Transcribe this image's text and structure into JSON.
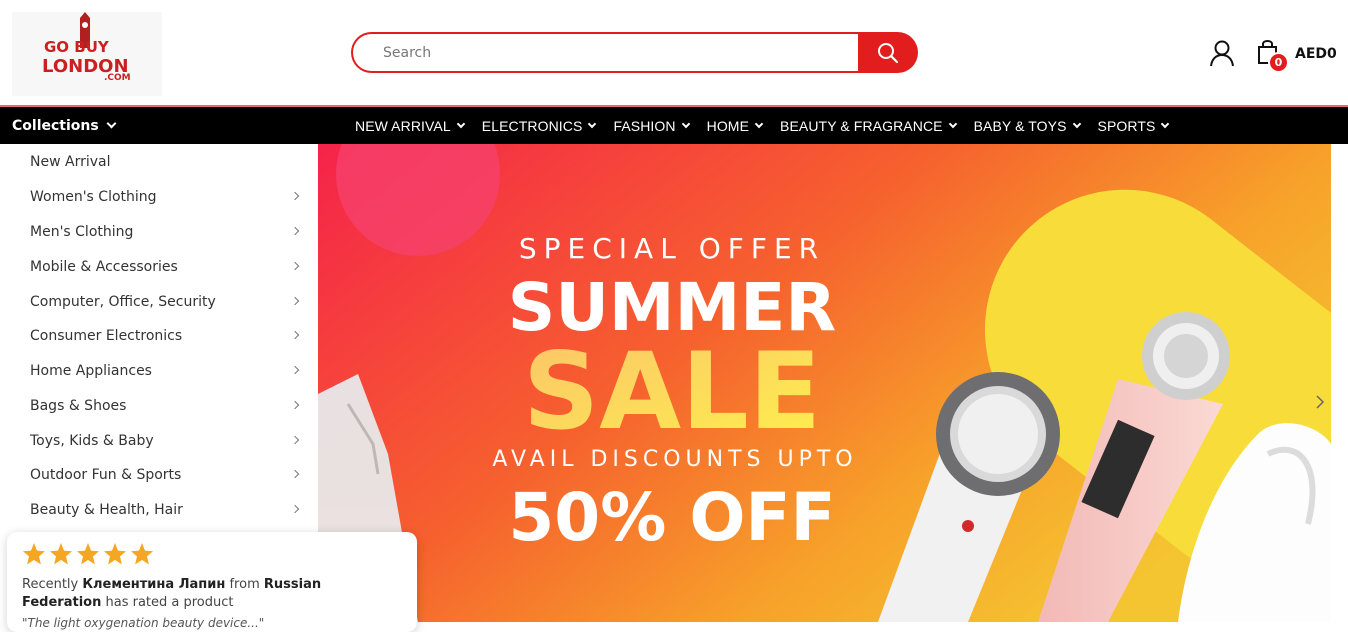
{
  "logo": {
    "alt": "GoBuyLondon.com",
    "text_top": "GO BUY",
    "text_bottom": "LONDON",
    "text_domain": ".COM"
  },
  "search": {
    "placeholder": "Search",
    "button_icon": "search-icon"
  },
  "header": {
    "user_icon": "user-icon",
    "cart_icon": "shopping-bag-icon",
    "cart_count": "0",
    "cart_total": "AED0"
  },
  "nav": {
    "collections_label": "Collections",
    "items": [
      {
        "label": "NEW ARRIVAL"
      },
      {
        "label": "ELECTRONICS"
      },
      {
        "label": "FASHION"
      },
      {
        "label": "HOME"
      },
      {
        "label": "BEAUTY & FRAGRANCE"
      },
      {
        "label": "BABY & TOYS"
      },
      {
        "label": "SPORTS"
      }
    ]
  },
  "sidebar": {
    "items": [
      {
        "label": "New Arrival",
        "has_submenu": false
      },
      {
        "label": "Women's Clothing",
        "has_submenu": true
      },
      {
        "label": "Men's Clothing",
        "has_submenu": true
      },
      {
        "label": "Mobile & Accessories",
        "has_submenu": true
      },
      {
        "label": "Computer, Office, Security",
        "has_submenu": true
      },
      {
        "label": "Consumer Electronics",
        "has_submenu": true
      },
      {
        "label": "Home Appliances",
        "has_submenu": true
      },
      {
        "label": "Bags & Shoes",
        "has_submenu": true
      },
      {
        "label": "Toys, Kids & Baby",
        "has_submenu": true
      },
      {
        "label": "Outdoor Fun & Sports",
        "has_submenu": true
      },
      {
        "label": "Beauty & Health, Hair",
        "has_submenu": true
      }
    ]
  },
  "banner": {
    "line1": "SPECIAL OFFER",
    "line2": "SUMMER",
    "line3": "SALE",
    "line4": "AVAIL DISCOUNTS UPTO",
    "line5": "50% OFF",
    "next_icon": "chevron-right-icon"
  },
  "review": {
    "rating": 5,
    "prefix": "Recently",
    "name": "Клементина Лапин",
    "from_word": "from",
    "country": "Russian Federation",
    "suffix": "has rated a product",
    "quote": "\"The light oxygenation beauty device...\""
  },
  "colors": {
    "brand_red": "#e21d1d",
    "nav_bg": "#000000",
    "star": "#f5a623"
  }
}
